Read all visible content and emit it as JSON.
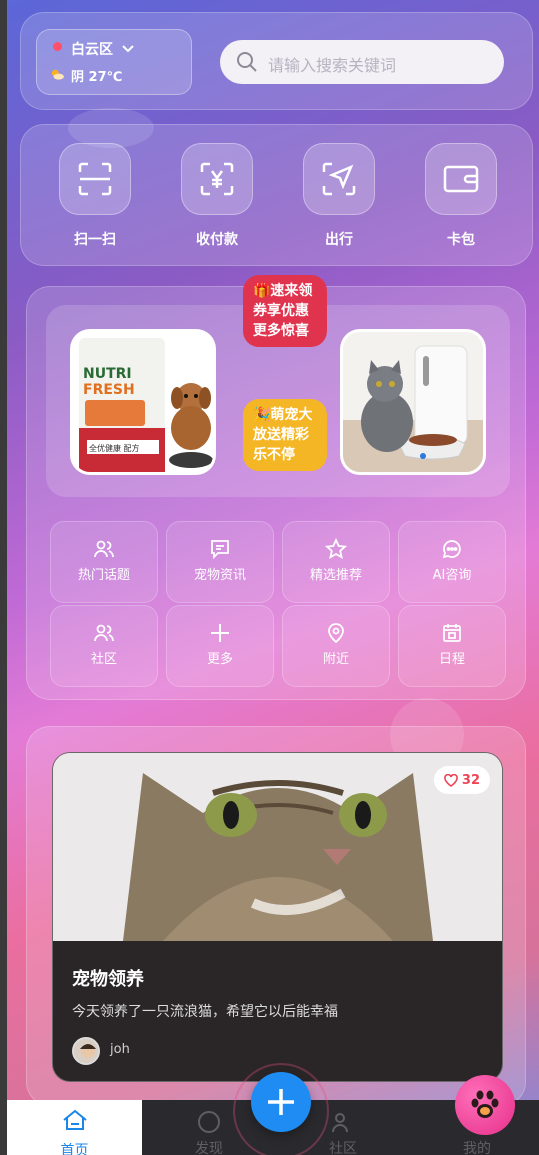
{
  "header": {
    "location": "白云区",
    "weather": "阴 27℃",
    "search_placeholder": "请输入搜索关键词"
  },
  "quick_actions": [
    {
      "label": "扫一扫",
      "icon": "scan-icon"
    },
    {
      "label": "收付款",
      "icon": "payment-icon"
    },
    {
      "label": "出行",
      "icon": "navigation-icon"
    },
    {
      "label": "卡包",
      "icon": "wallet-icon"
    }
  ],
  "promo": {
    "badge_top": "🎁速来领券享优惠更多惊喜",
    "badge_bottom": "🎉萌宠大放送精彩乐不停",
    "product_text": [
      "NUTRI",
      "FRESH",
      "全优健康 配方"
    ]
  },
  "features": [
    {
      "label": "热门话题",
      "icon": "users-icon"
    },
    {
      "label": "宠物资讯",
      "icon": "message-icon"
    },
    {
      "label": "精选推荐",
      "icon": "star-icon"
    },
    {
      "label": "AI咨询",
      "icon": "chat-icon"
    },
    {
      "label": "社区",
      "icon": "users-icon"
    },
    {
      "label": "更多",
      "icon": "plus-icon"
    },
    {
      "label": "附近",
      "icon": "location-icon"
    },
    {
      "label": "日程",
      "icon": "calendar-icon"
    }
  ],
  "post": {
    "likes": "32",
    "title": "宠物领养",
    "description": "今天领养了一只流浪猫，希望它以后能幸福",
    "username": "joh"
  },
  "nav": {
    "home": "首页",
    "discover": "发现",
    "community": "社区",
    "mine": "我的"
  },
  "colors": {
    "fab": "#1e8cf2",
    "paw": "#e52f8a",
    "badge_red": "#e0344e",
    "badge_yellow": "#f5b625",
    "like": "#ee4456"
  }
}
